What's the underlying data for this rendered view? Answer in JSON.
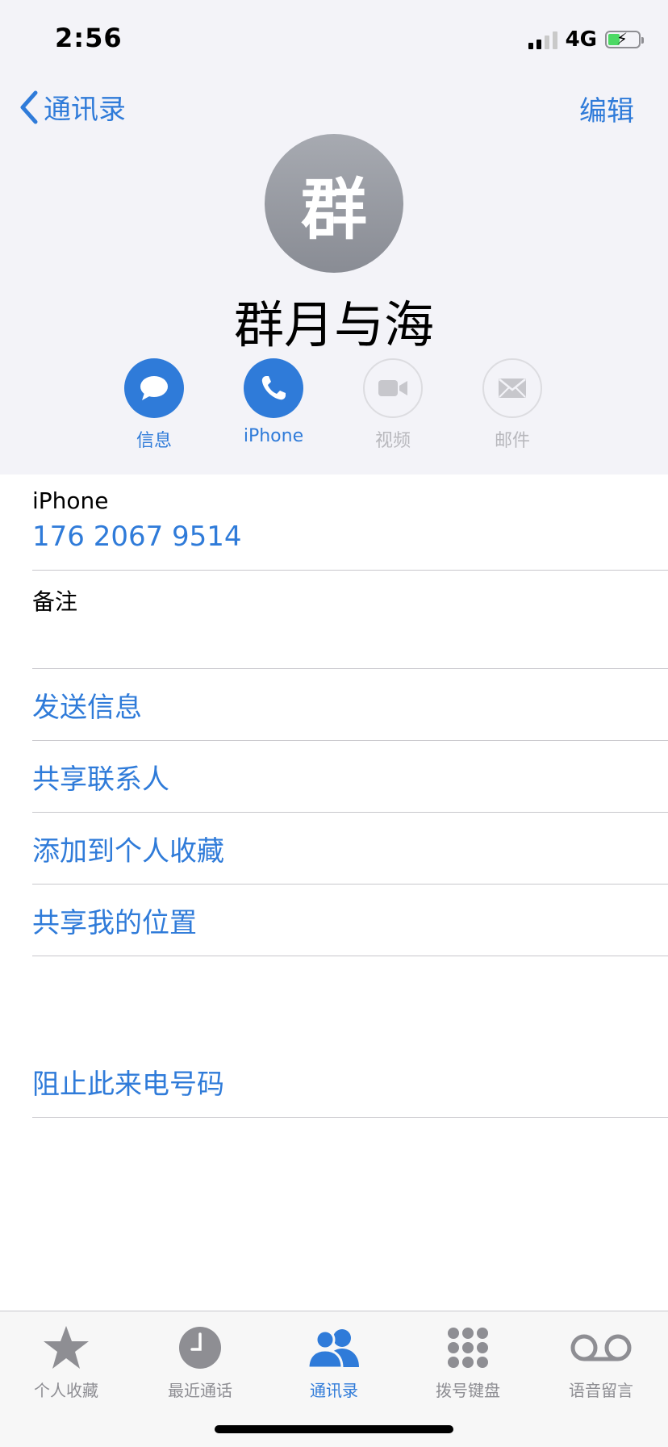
{
  "status_bar": {
    "time": "2:56",
    "network": "4G"
  },
  "nav": {
    "back_label": "通讯录",
    "edit_label": "编辑"
  },
  "contact": {
    "avatar_text": "群",
    "name": "群月与海"
  },
  "actions": [
    {
      "label": "信息",
      "icon": "message-bubble-icon",
      "enabled": true
    },
    {
      "label": "iPhone",
      "icon": "phone-icon",
      "enabled": true
    },
    {
      "label": "视频",
      "icon": "video-camera-icon",
      "enabled": false
    },
    {
      "label": "邮件",
      "icon": "envelope-icon",
      "enabled": false
    }
  ],
  "phone_field": {
    "label": "iPhone",
    "value": "176 2067 9514"
  },
  "notes_field": {
    "label": "备注",
    "value": ""
  },
  "links": [
    {
      "label": "发送信息"
    },
    {
      "label": "共享联系人"
    },
    {
      "label": "添加到个人收藏"
    },
    {
      "label": "共享我的位置"
    }
  ],
  "block_link": {
    "label": "阻止此来电号码"
  },
  "tabs": [
    {
      "label": "个人收藏",
      "icon": "star-icon",
      "active": false
    },
    {
      "label": "最近通话",
      "icon": "clock-icon",
      "active": false
    },
    {
      "label": "通讯录",
      "icon": "contacts-icon",
      "active": true
    },
    {
      "label": "拨号键盘",
      "icon": "keypad-icon",
      "active": false
    },
    {
      "label": "语音留言",
      "icon": "voicemail-icon",
      "active": false
    }
  ],
  "colors": {
    "accent": "#2f7bd9",
    "header_bg": "#f3f3f8",
    "disabled": "#b8b8bd",
    "tab_inactive": "#8e8e93",
    "battery": "#4cd964"
  }
}
